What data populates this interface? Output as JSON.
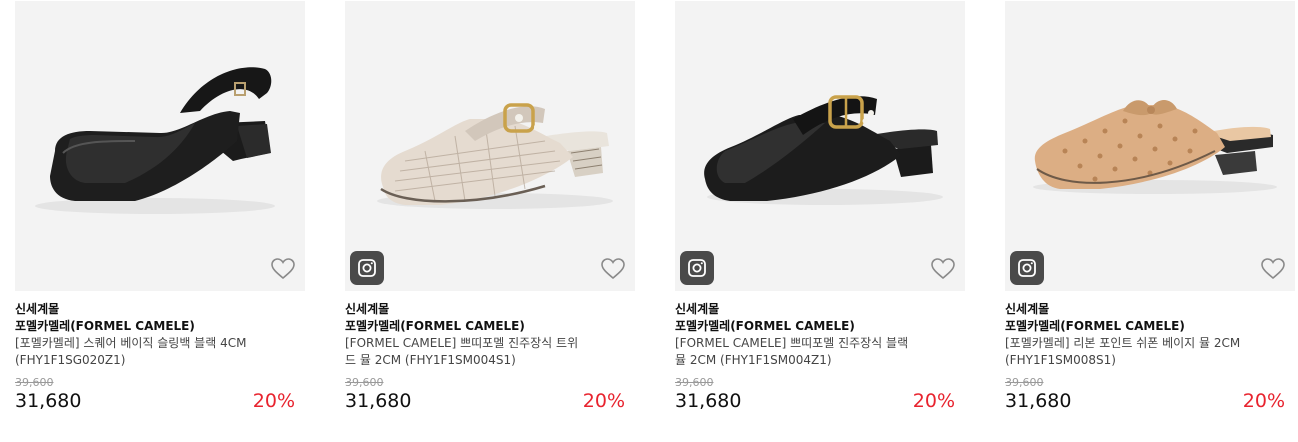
{
  "colors": {
    "discount": "#e8232e",
    "thumb_bg": "#f3f3f3",
    "insta_badge": "#4a4a4a"
  },
  "products": [
    {
      "store": "신세계몰",
      "brand": "포멜카멜레(FORMEL CAMELE)",
      "name_line1": "[포멜카멜레] 스퀘어 베이직 슬링백 블랙 4CM",
      "name_line2": "(FHY1F1SG020Z1)",
      "original_price": "39,600",
      "price": "31,680",
      "discount": "20%",
      "has_instagram_badge": false,
      "wishlist_icon": "heart-outline-icon"
    },
    {
      "store": "신세계몰",
      "brand": "포멜카멜레(FORMEL CAMELE)",
      "name_line1": "[FORMEL CAMELE] 쁘띠포멜 진주장식 트위",
      "name_line2": "드 뮬 2CM (FHY1F1SM004S1)",
      "original_price": "39,600",
      "price": "31,680",
      "discount": "20%",
      "has_instagram_badge": true,
      "wishlist_icon": "heart-outline-icon"
    },
    {
      "store": "신세계몰",
      "brand": "포멜카멜레(FORMEL CAMELE)",
      "name_line1": "[FORMEL CAMELE] 쁘띠포멜 진주장식 블랙",
      "name_line2": "뮬 2CM (FHY1F1SM004Z1)",
      "original_price": "39,600",
      "price": "31,680",
      "discount": "20%",
      "has_instagram_badge": true,
      "wishlist_icon": "heart-outline-icon"
    },
    {
      "store": "신세계몰",
      "brand": "포멜카멜레(FORMEL CAMELE)",
      "name_line1": "[포멜카멜레] 리본 포인트 쉬폰 베이지 뮬 2CM",
      "name_line2": "(FHY1F1SM008S1)",
      "original_price": "39,600",
      "price": "31,680",
      "discount": "20%",
      "has_instagram_badge": true,
      "wishlist_icon": "heart-outline-icon"
    }
  ]
}
